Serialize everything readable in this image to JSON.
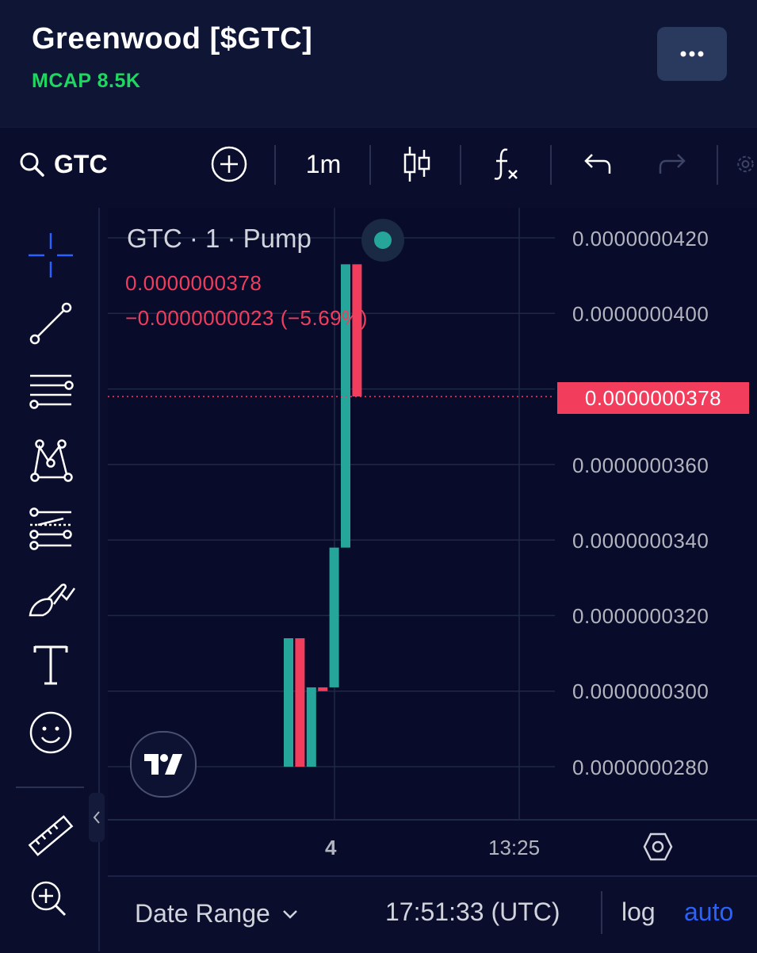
{
  "header": {
    "title": "Greenwood [$GTC]",
    "mcap": "MCAP 8.5K",
    "more_icon": "ellipsis-icon"
  },
  "toolbar": {
    "symbol": "GTC",
    "interval": "1m",
    "icons": [
      "search-icon",
      "add-circle-icon",
      "candles-icon",
      "indicators-icon",
      "undo-icon",
      "redo-icon",
      "settings-icon"
    ]
  },
  "sidebar": {
    "tools": [
      "crosshair-icon",
      "trend-line-icon",
      "fib-lines-icon",
      "pattern-icon",
      "projection-icon",
      "brush-icon",
      "text-icon",
      "emoji-icon",
      "ruler-icon",
      "zoom-in-icon"
    ]
  },
  "chart": {
    "legend_title": "GTC · 1 · Pump",
    "last_price": "0.0000000378",
    "change": "−0.0000000023 (−5.69%)",
    "current_price_tag": "0.0000000378",
    "y_axis_labels": [
      "0.0000000420",
      "0.0000000400",
      "0.0000000360",
      "0.0000000340",
      "0.0000000320",
      "0.0000000300",
      "0.0000000280"
    ],
    "x_axis_labels": [
      "4",
      "13:25"
    ],
    "colors": {
      "up": "#26a69a",
      "down": "#f23d5c",
      "background": "#080b2a"
    }
  },
  "chart_data": {
    "type": "candlestick",
    "y_unit": "price",
    "ylim": [
      2.65e-08,
      4.33e-08
    ],
    "candles": [
      {
        "open": 3.14e-08,
        "high": 3.14e-08,
        "low": 2.8e-08,
        "close": 2.8e-08,
        "direction": "up"
      },
      {
        "open": 3.14e-08,
        "high": 3.14e-08,
        "low": 2.8e-08,
        "close": 2.8e-08,
        "direction": "down"
      },
      {
        "open": 2.8e-08,
        "high": 3.01e-08,
        "low": 2.8e-08,
        "close": 3.01e-08,
        "direction": "up"
      },
      {
        "open": 3.01e-08,
        "high": 3.01e-08,
        "low": 3e-08,
        "close": 3e-08,
        "direction": "down"
      },
      {
        "open": 3.01e-08,
        "high": 3.38e-08,
        "low": 3.01e-08,
        "close": 3.38e-08,
        "direction": "up"
      },
      {
        "open": 3.38e-08,
        "high": 4.13e-08,
        "low": 3.38e-08,
        "close": 4.13e-08,
        "direction": "up"
      },
      {
        "open": 4.13e-08,
        "high": 4.13e-08,
        "low": 3.78e-08,
        "close": 3.78e-08,
        "direction": "down"
      }
    ],
    "legend": "GTC · 1 · Pump",
    "x_ticks": [
      "4",
      "13:25"
    ]
  },
  "bottom_bar": {
    "date_range": "Date Range",
    "time": "17:51:33 (UTC)",
    "log": "log",
    "auto": "auto"
  }
}
